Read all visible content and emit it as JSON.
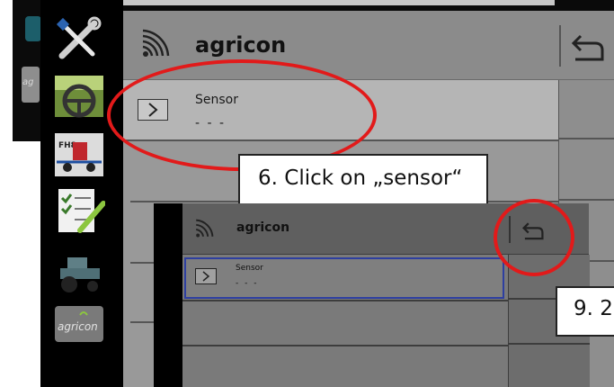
{
  "background_app": {
    "mini_button_label": "ag"
  },
  "sidebar": {
    "items": [
      {
        "icon": "tools-icon"
      },
      {
        "icon": "steering-icon"
      },
      {
        "icon": "sprayer-icon",
        "label": "FH8"
      },
      {
        "icon": "checklist-icon"
      },
      {
        "icon": "tractor-icon"
      },
      {
        "icon": "agricon-logo-icon",
        "label": "agricon"
      }
    ]
  },
  "header": {
    "title": "agricon",
    "icon": "wireless-signal-icon",
    "back_icon": "back-return-icon"
  },
  "list": {
    "rows": [
      {
        "label": "Sensor",
        "value": "- - -"
      }
    ]
  },
  "annotations": {
    "step6": "6. Click on „sensor“",
    "step9": "9. 2",
    "highlight_color": "#e21a1a"
  },
  "inner_screenshot": {
    "title": "agricon",
    "row_label": "Sensor",
    "row_value": "- - -",
    "selection_color": "#2e3fa0"
  },
  "colors": {
    "screen_grey": "#9a9a9a",
    "header_grey": "#8b8b8b",
    "bezel": "#000000"
  }
}
